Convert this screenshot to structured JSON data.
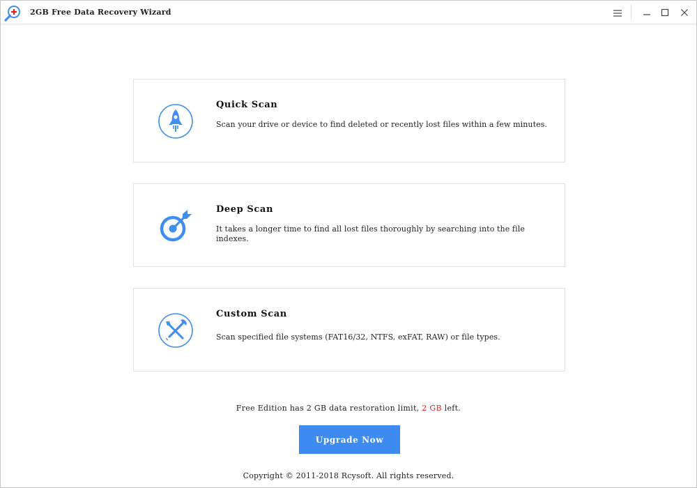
{
  "window": {
    "title": "2GB Free Data Recovery Wizard",
    "icons": {
      "app": "magnifier-plus-icon",
      "menu": "hamburger-menu-icon",
      "minimize": "minimize-icon",
      "maximize": "maximize-icon",
      "close": "close-icon"
    }
  },
  "scan_options": [
    {
      "title": "Quick Scan",
      "description": "Scan your drive or device to find deleted or recently lost files within a few minutes.",
      "icon": "rocket-icon"
    },
    {
      "title": "Deep Scan",
      "description": "It takes a longer time to find all lost files thoroughly by searching into the file indexes.",
      "icon": "target-dart-icon"
    },
    {
      "title": "Custom Scan",
      "description": "Scan specified file systems (FAT16/32, NTFS, exFAT, RAW) or file types.",
      "icon": "tools-icon"
    }
  ],
  "footer": {
    "limit_prefix": "Free Edition has 2 GB data restoration limit,",
    "limit_amount": "2 GB",
    "limit_suffix": "left.",
    "upgrade_label": "Upgrade Now",
    "copyright": "Copyright © 2011-2018 Rcysoft. All rights reserved."
  },
  "colors": {
    "accent": "#3d8bf0",
    "icon_blue": "#3f8ef2",
    "limit_highlight": "#e02020",
    "card_border": "#e2e2e2"
  }
}
